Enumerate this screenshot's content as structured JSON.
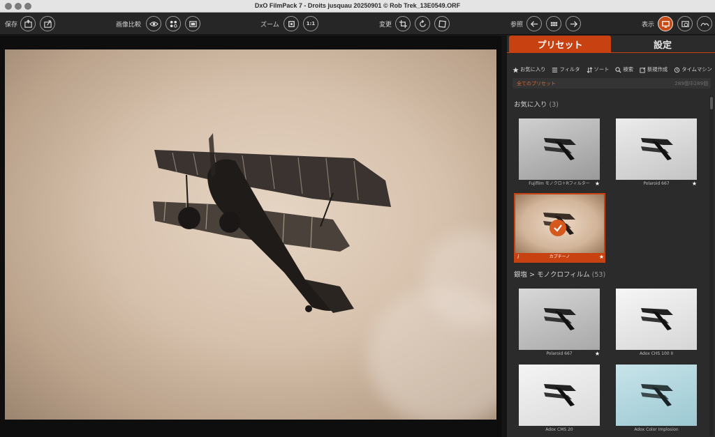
{
  "window": {
    "title": "DxO FilmPack 7 - Droits jusquau 20250901 © Rob Trek_13E0549.ORF"
  },
  "toolbar": {
    "save_label": "保存",
    "compare_label": "画像比較",
    "zoom_label": "ズーム",
    "zoom_one_to_one": "1:1",
    "transform_label": "変更",
    "browse_label": "参照",
    "display_label": "表示"
  },
  "panel": {
    "tabs": {
      "presets": "プリセット",
      "settings": "設定"
    },
    "filters": {
      "favorites": "お気に入り",
      "filter": "フィルタ",
      "sort": "ソート",
      "search": "検索",
      "new": "新規作成",
      "time_machine": "タイムマシン"
    },
    "all_presets": {
      "label": "全てのプリセット",
      "count": "289個中289個"
    },
    "sections": {
      "favorites": {
        "title": "お気に入り",
        "count": "(3)"
      },
      "silver": {
        "title": "銀塩 > モノクロフィルム",
        "count": "(53)"
      }
    },
    "thumbs": {
      "t1": "Fujifilm モノクロ＋Rフィルター",
      "t2": "Polaroid 667",
      "t3": "カプチーノ",
      "t4": "Polaroid 667",
      "t5": "Adox CHS 100 II",
      "t6": "Adox CMS 20",
      "t7": "Adox Color Implosion"
    },
    "star": "★",
    "info": "i"
  },
  "colors": {
    "accent": "#c84110",
    "panel_bg": "#2b2b2b",
    "toolbar_bg": "#262626"
  }
}
